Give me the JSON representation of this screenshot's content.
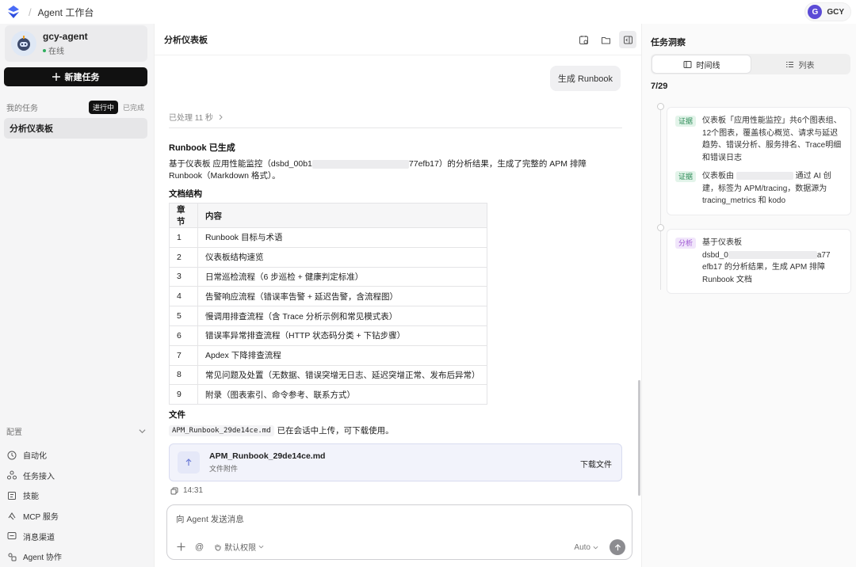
{
  "topbar": {
    "breadcrumb_sep": "/",
    "breadcrumb": "Agent 工作台",
    "user_initial": "G",
    "user_name": "GCY"
  },
  "sidebar": {
    "agent_name": "gcy-agent",
    "agent_status": "在线",
    "new_task_label": "新建任务",
    "my_tasks_label": "我的任务",
    "filter_active": "进行中",
    "filter_done": "已完成",
    "task_selected": "分析仪表板",
    "config_label": "配置",
    "nav": [
      {
        "label": "自动化",
        "icon": "clock-icon"
      },
      {
        "label": "任务接入",
        "icon": "webhook-icon"
      },
      {
        "label": "技能",
        "icon": "skill-icon"
      },
      {
        "label": "MCP 服务",
        "icon": "mcp-icon"
      },
      {
        "label": "消息渠道",
        "icon": "message-icon"
      },
      {
        "label": "Agent 协作",
        "icon": "collab-icon"
      }
    ]
  },
  "main": {
    "title": "分析仪表板",
    "user_message": "生成 Runbook",
    "processed": "已处理 11 秒",
    "heading": "Runbook 已生成",
    "desc_part1": "基于仪表板 应用性能监控（dsbd_00b1",
    "desc_part2": "77efb17）的分析结果，生成了完整的 APM 排障",
    "desc_line2": "Runbook（Markdown 格式）。",
    "structure_heading": "文档结构",
    "table": {
      "headers": [
        "章节",
        "内容"
      ],
      "rows": [
        [
          "1",
          "Runbook 目标与术语"
        ],
        [
          "2",
          "仪表板结构速览"
        ],
        [
          "3",
          "日常巡检流程（6 步巡检 + 健康判定标准）"
        ],
        [
          "4",
          "告警响应流程（错误率告警 + 延迟告警，含流程图）"
        ],
        [
          "5",
          "慢调用排查流程（含 Trace 分析示例和常见模式表）"
        ],
        [
          "6",
          "错误率异常排查流程（HTTP 状态码分类 + 下钻步骤）"
        ],
        [
          "7",
          "Apdex 下降排查流程"
        ],
        [
          "8",
          "常见问题及处置（无数据、错误突增无日志、延迟突增正常、发布后异常）"
        ],
        [
          "9",
          "附录（图表索引、命令参考、联系方式）"
        ]
      ]
    },
    "file_heading": "文件",
    "file_code": "APM_Runbook_29de14ce.md",
    "file_text": "已在会话中上传，可下载使用。",
    "file_card_name": "APM_Runbook_29de14ce.md",
    "file_card_sub": "文件附件",
    "download_label": "下载文件",
    "time": "14:31",
    "composer_placeholder": "向 Agent 发送消息",
    "permission_label": "默认权限",
    "model_label": "Auto"
  },
  "insights": {
    "title": "任务洞察",
    "tab_timeline": "时间线",
    "tab_list": "列表",
    "date": "7/29",
    "card1": {
      "e1_tag": "证据",
      "e1_text": "仪表板「应用性能监控」共6个图表组、12个图表，覆盖核心概览、请求与延迟趋势、错误分析、服务排名、Trace明细和错误日志",
      "e2_tag": "证据",
      "e2_text_a": "仪表板由",
      "e2_text_b": "通过 AI 创建，标签为 APM/tracing，数据源为 tracing_metrics 和 kodo"
    },
    "card2": {
      "tag": "分析",
      "text_a": "基于仪表板",
      "text_b": "dsbd_0",
      "text_c": "a77",
      "text_d": "efb17 的分析结果，生成 APM 排障 Runbook 文档"
    }
  }
}
